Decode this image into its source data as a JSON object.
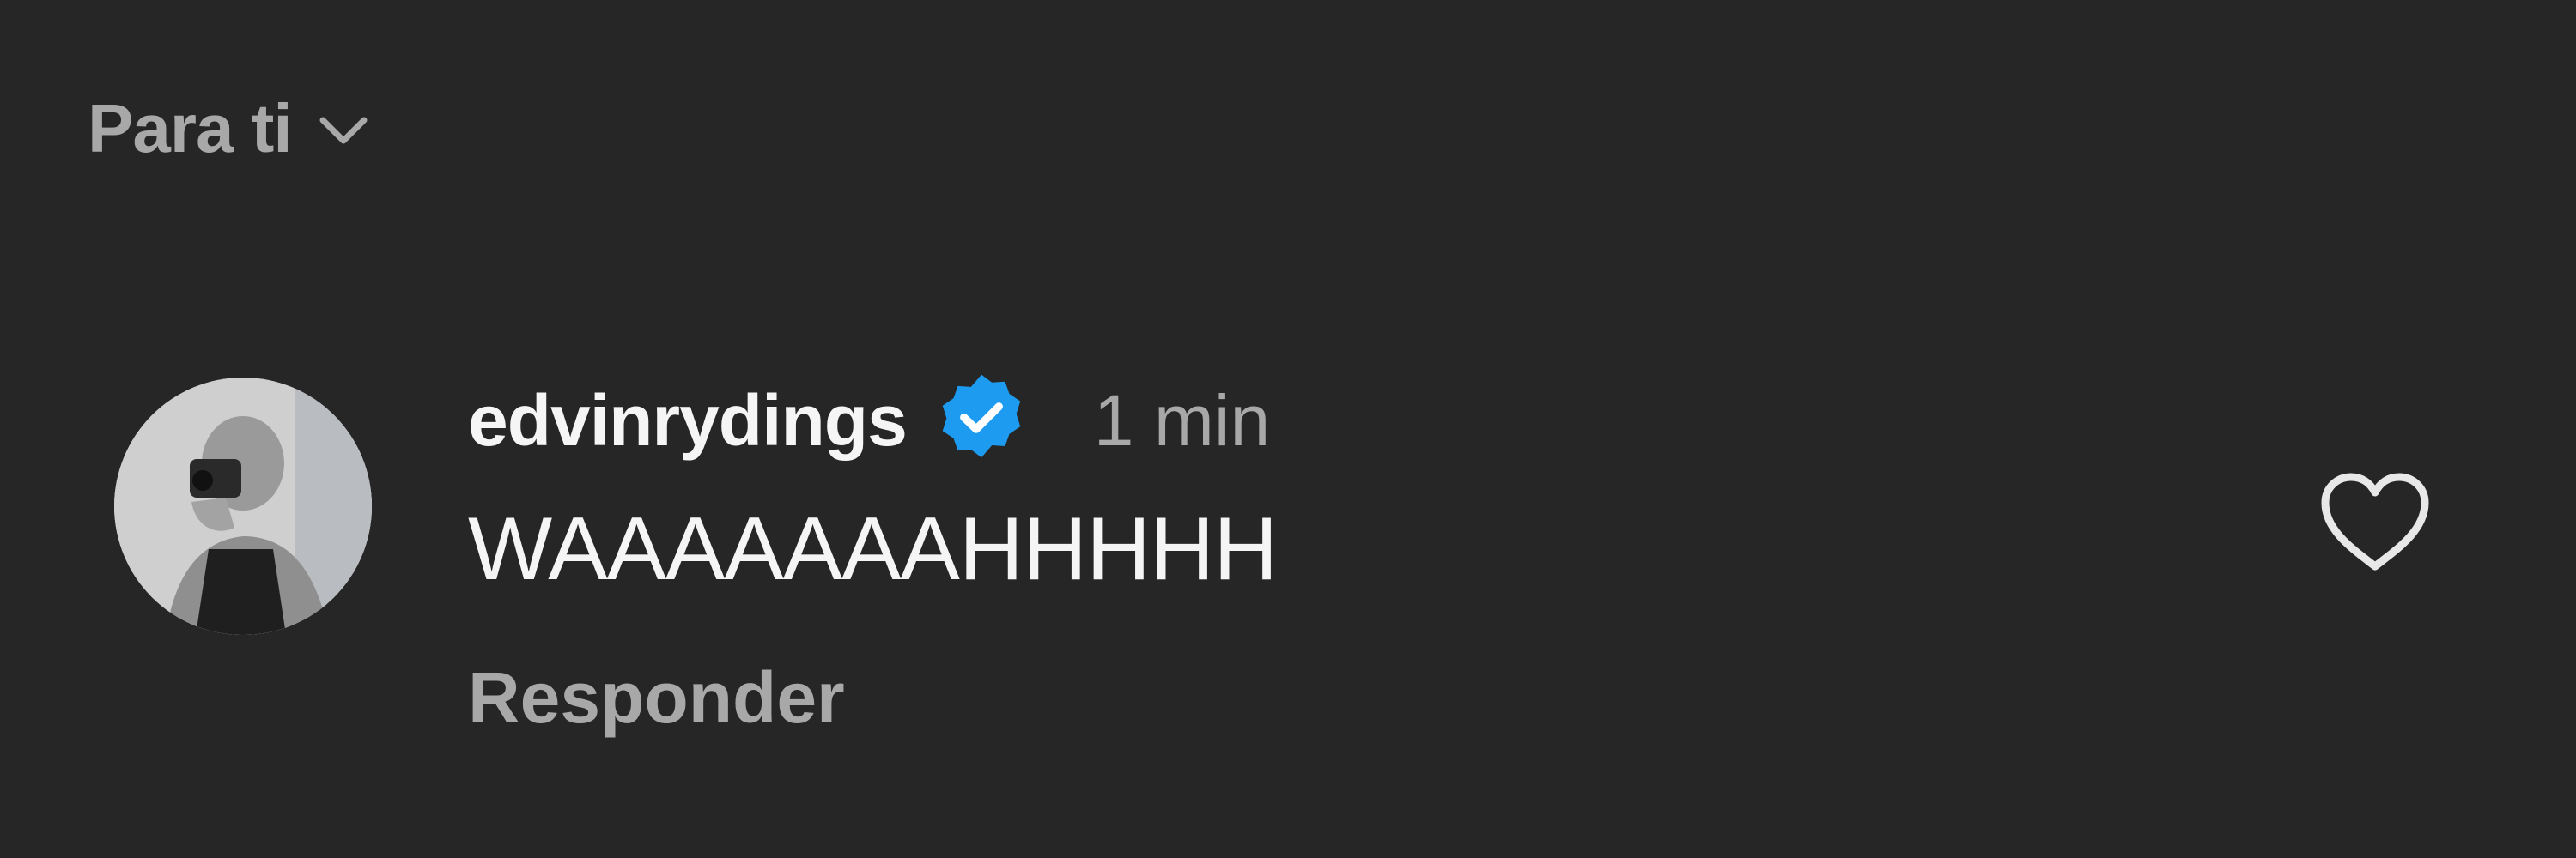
{
  "filter": {
    "label": "Para ti",
    "icon": "chevron-down-icon"
  },
  "comment": {
    "avatar_icon": "user-avatar-photo",
    "username": "edvinrydings",
    "verified": true,
    "verified_icon": "verified-badge-icon",
    "timestamp": "1 min",
    "text": "WAAAAAAAHHHHH",
    "reply_label": "Responder",
    "like_icon": "heart-outline-icon"
  },
  "colors": {
    "background": "#262626",
    "primary_text": "#f5f5f5",
    "secondary_text": "#a8a8a8",
    "verified_blue": "#1d9bf0"
  }
}
